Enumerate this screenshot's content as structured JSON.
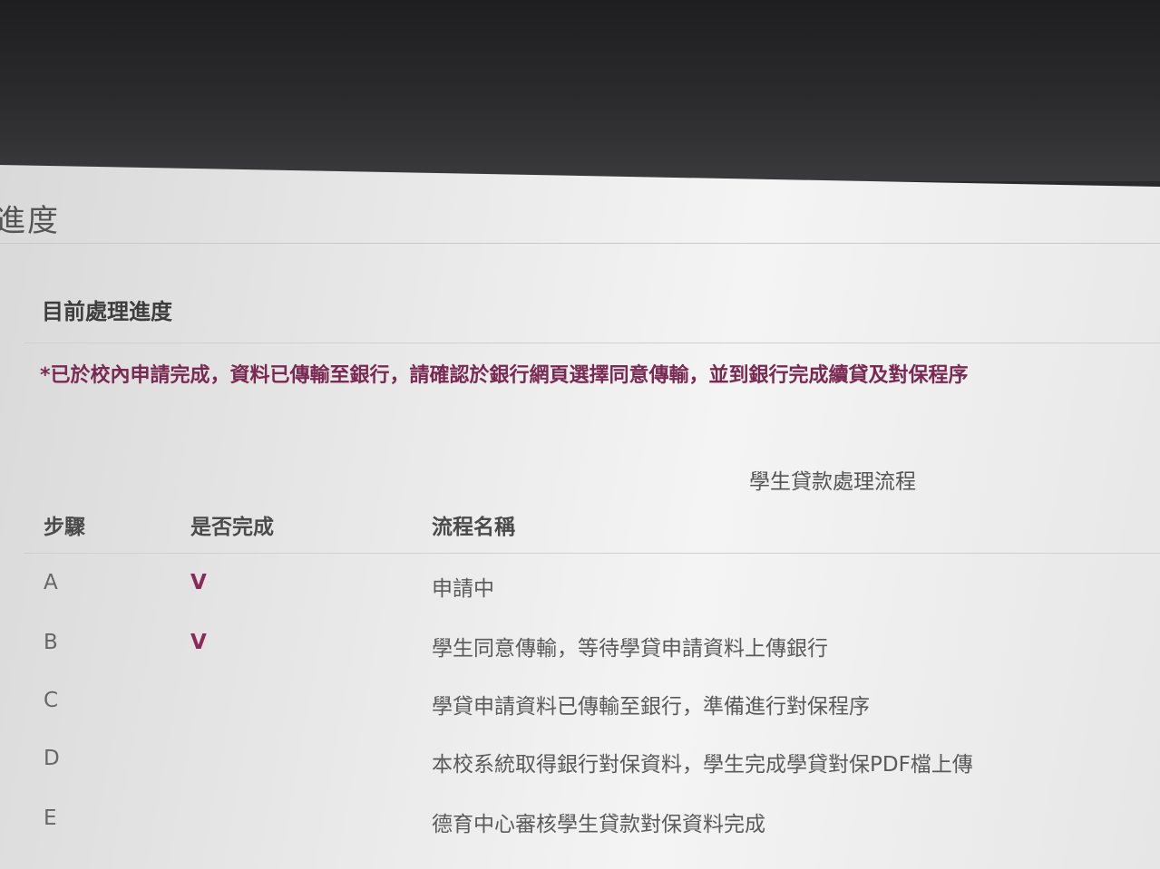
{
  "page": {
    "title_fragment": "進度"
  },
  "panel": {
    "heading": "目前處理進度",
    "notice": "*已於校內申請完成，資料已傳輸至銀行，請確認於銀行網頁選擇同意傳輸，並到銀行完成續貸及對保程序",
    "notice_color": "#7a2a52"
  },
  "table": {
    "caption": "學生貸款處理流程",
    "headers": {
      "step": "步驟",
      "done": "是否完成",
      "name": "流程名稱"
    },
    "rows": [
      {
        "step": "A",
        "done": "V",
        "name": "申請中"
      },
      {
        "step": "B",
        "done": "V",
        "name": "學生同意傳輸，等待學貸申請資料上傳銀行"
      },
      {
        "step": "C",
        "done": "",
        "name": "學貸申請資料已傳輸至銀行，準備進行對保程序"
      },
      {
        "step": "D",
        "done": "",
        "name": "本校系統取得銀行對保資料，學生完成學貸對保PDF檔上傳"
      },
      {
        "step": "E",
        "done": "",
        "name": "德育中心審核學生貸款對保資料完成"
      }
    ]
  }
}
